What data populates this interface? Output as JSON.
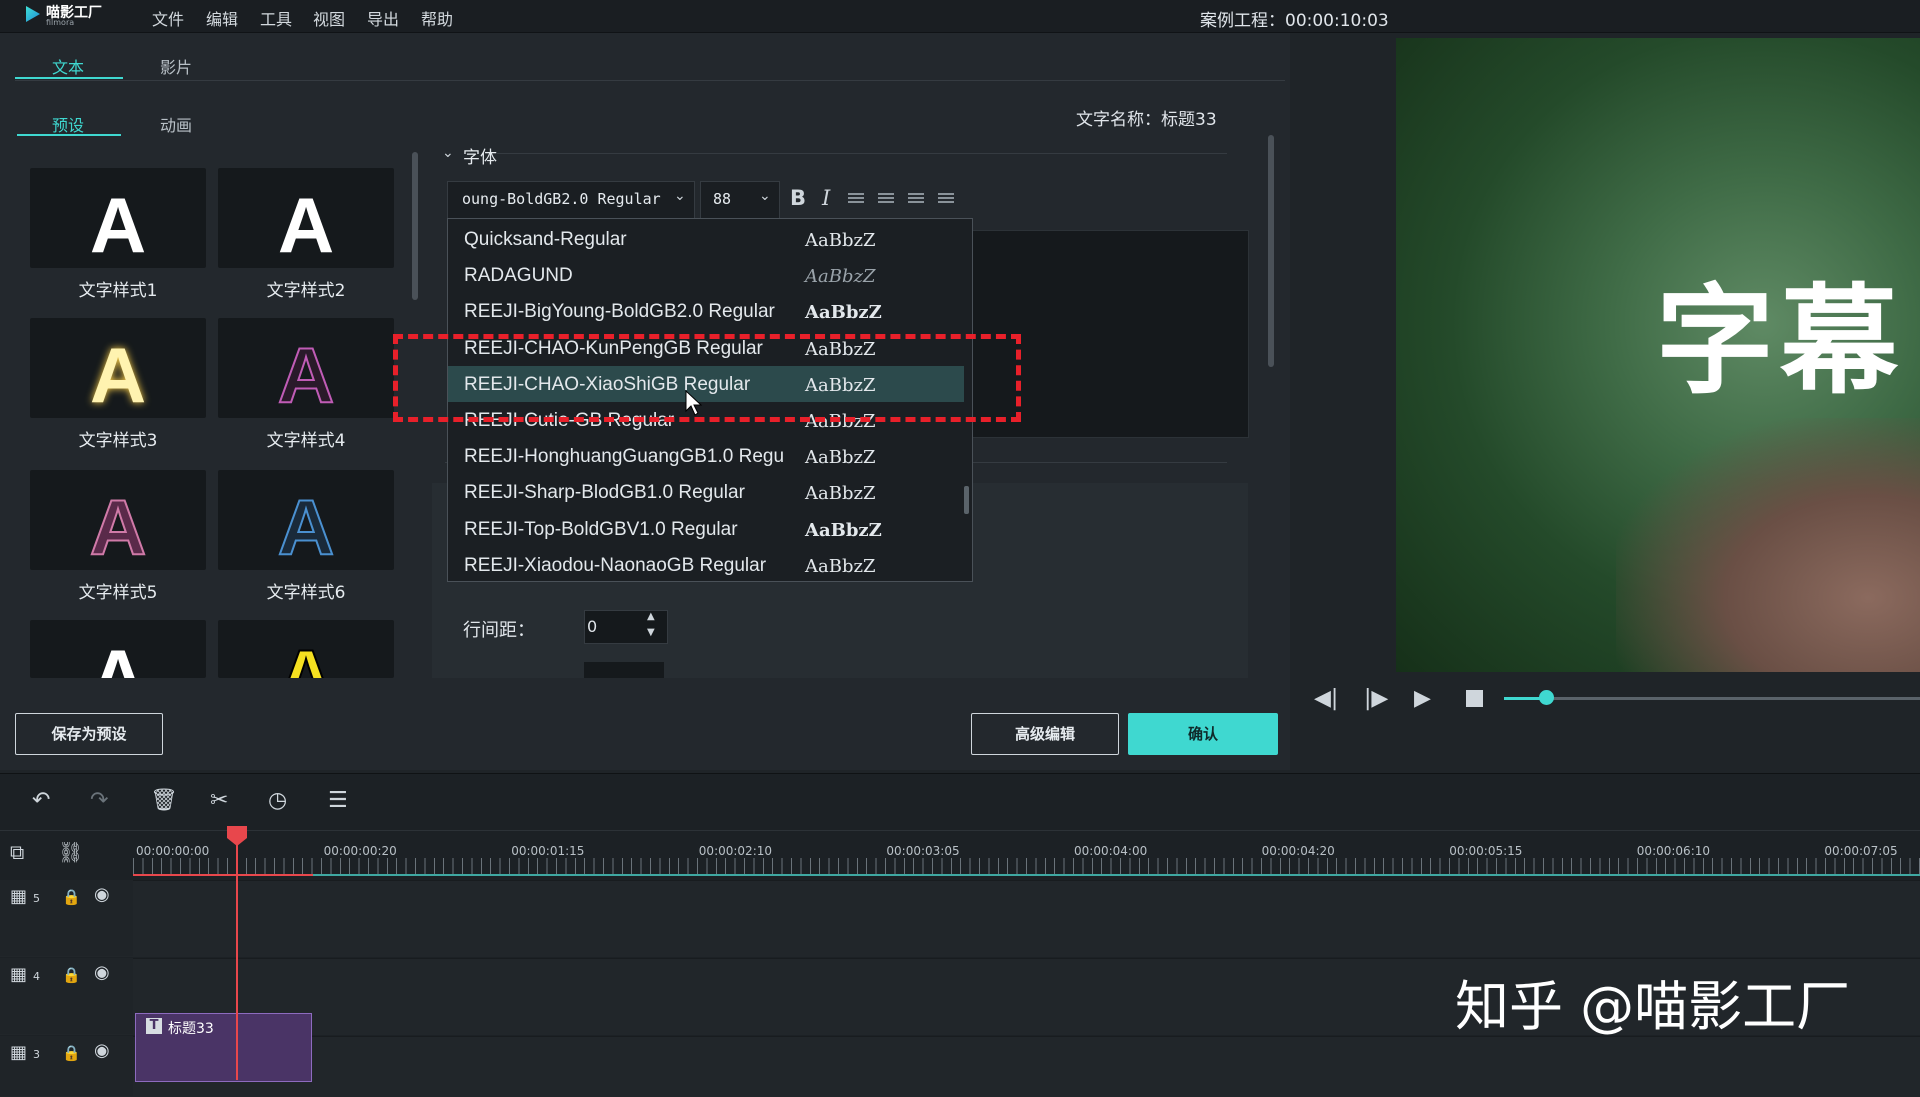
{
  "app": {
    "name": "喵影工厂",
    "name_sub": "filmora",
    "menu": [
      "文件",
      "编辑",
      "工具",
      "视图",
      "导出",
      "帮助"
    ],
    "project_label": "案例工程：00:00:10:03"
  },
  "editor": {
    "main_tabs": [
      "文本",
      "影片"
    ],
    "sub_tabs": [
      "预设",
      "动画"
    ],
    "text_name_label": "文字名称：标题33",
    "presets": [
      {
        "label": "文字样式1",
        "color": "#ffffff"
      },
      {
        "label": "文字样式2",
        "color": "#ffffff"
      },
      {
        "label": "文字样式3",
        "color": "#fff3b0"
      },
      {
        "label": "文字样式4",
        "color": "#2a1a2a"
      },
      {
        "label": "文字样式5",
        "color": "#5a2a4a"
      },
      {
        "label": "文字样式6",
        "color": "#1a2a3a"
      },
      {
        "label": "",
        "color": "#ffffff"
      },
      {
        "label": "",
        "color": "#f5e020"
      }
    ],
    "section_font": "字体",
    "font_value": "oung-BoldGB2.0 Regular",
    "size_value": "88",
    "line_spacing_label": "行间距：",
    "line_spacing_value": "0",
    "save_preset": "保存为预设",
    "advanced_edit": "高级编辑",
    "confirm": "确认"
  },
  "font_dropdown": [
    {
      "name": "Quicksand-Regular",
      "preview": "AaBbzZ"
    },
    {
      "name": "RADAGUND",
      "preview": "AaBbzZ"
    },
    {
      "name": "REEJI-BigYoung-BoldGB2.0 Regular",
      "preview": "AaBbzZ"
    },
    {
      "name": "REEJI-CHAO-KunPengGB Regular",
      "preview": "AaBbzZ"
    },
    {
      "name": "REEJI-CHAO-XiaoShiGB Regular",
      "preview": "AaBbzZ"
    },
    {
      "name": "REEJI-Cutie-GB Regular",
      "preview": "AaBbzZ"
    },
    {
      "name": "REEJI-HonghuangGuangGB1.0 Regu",
      "preview": "AaBbzZ"
    },
    {
      "name": "REEJI-Sharp-BlodGB1.0 Regular",
      "preview": "AaBbzZ"
    },
    {
      "name": "REEJI-Top-BoldGBV1.0 Regular",
      "preview": "AaBbzZ"
    },
    {
      "name": "REEJI-Xiaodou-NaonaoGB Regular",
      "preview": "AaBbzZ"
    }
  ],
  "highlighted_font_index": 4,
  "preview": {
    "subtitle": "字幕"
  },
  "timeline": {
    "ticks": [
      "00:00:00:00",
      "00:00:00:20",
      "00:00:01:15",
      "00:00:02:10",
      "00:00:03:05",
      "00:00:04:00",
      "00:00:04:20",
      "00:00:05:15",
      "00:00:06:10",
      "00:00:07:05"
    ],
    "tracks": [
      "5",
      "4",
      "3"
    ],
    "clip_label": "标题33"
  },
  "watermark": "知乎 @喵影工厂",
  "colors": {
    "accent": "#3fd8d0",
    "highlight_box": "#e8202a",
    "playhead": "#e8474c"
  }
}
